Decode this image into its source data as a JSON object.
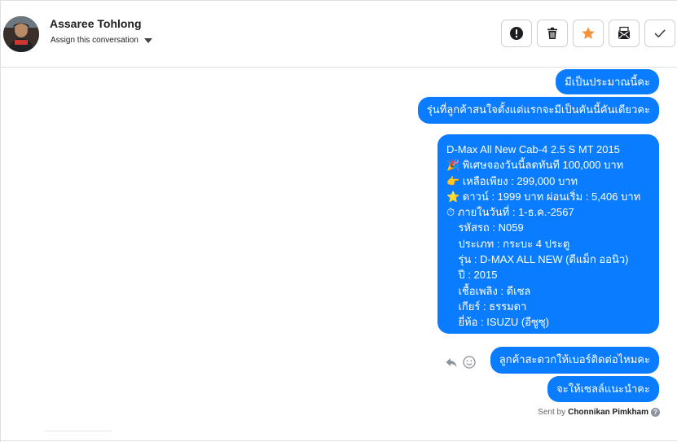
{
  "header": {
    "user_name": "Assaree Tohlong",
    "assign_label": "Assign this conversation"
  },
  "actions": [
    {
      "name": "mark-spam",
      "icon": "exclamation-circle-icon"
    },
    {
      "name": "delete",
      "icon": "trash-icon"
    },
    {
      "name": "star",
      "icon": "star-icon",
      "color": "#f7923b"
    },
    {
      "name": "mark-unread",
      "icon": "envelope-icon"
    },
    {
      "name": "mark-done",
      "icon": "checkmark-icon"
    }
  ],
  "messages": {
    "m1": "มีเป็นประมาณนี้คะ",
    "m2": "รุ่นที่ลูกค้าสนใจตั้งแต่แรกจะมีเป็นคันนี้คันเดียวคะ",
    "m3": "D-Max All New Cab-4 2.5 S MT 2015\n🎉 พิเศษจองวันนี้ลดทันที 100,000 บาท\n👉 เหลือเพียง : 299,000 บาท\n⭐ ดาวน์ : 1999 บาท ผ่อนเริ่ม : 5,406 บาท\n⏱ ภายในวันที่ : 1-ธ.ค.-2567\n    รหัสรถ : N059\n    ประเภท : กระบะ 4 ประตู\n    รุ่น : D-MAX ALL NEW (ดีแม็ก ออนิว)\n    ปี : 2015\n    เชื้อเพลิง : ดีเซล\n    เกียร์ : ธรรมดา\n    ยี่ห้อ : ISUZU (อีซูซุ)",
    "m4": "ลูกค้าสะดวกให้เบอร์ติดต่อไหมคะ",
    "m5": "จะให้เซลล์แนะนำคะ"
  },
  "sent_by": {
    "prefix": "Sent by",
    "agent": "Chonnikan Pimkham",
    "help": "?"
  },
  "colors": {
    "bubble": "#0a7cff",
    "star": "#f7923b"
  }
}
